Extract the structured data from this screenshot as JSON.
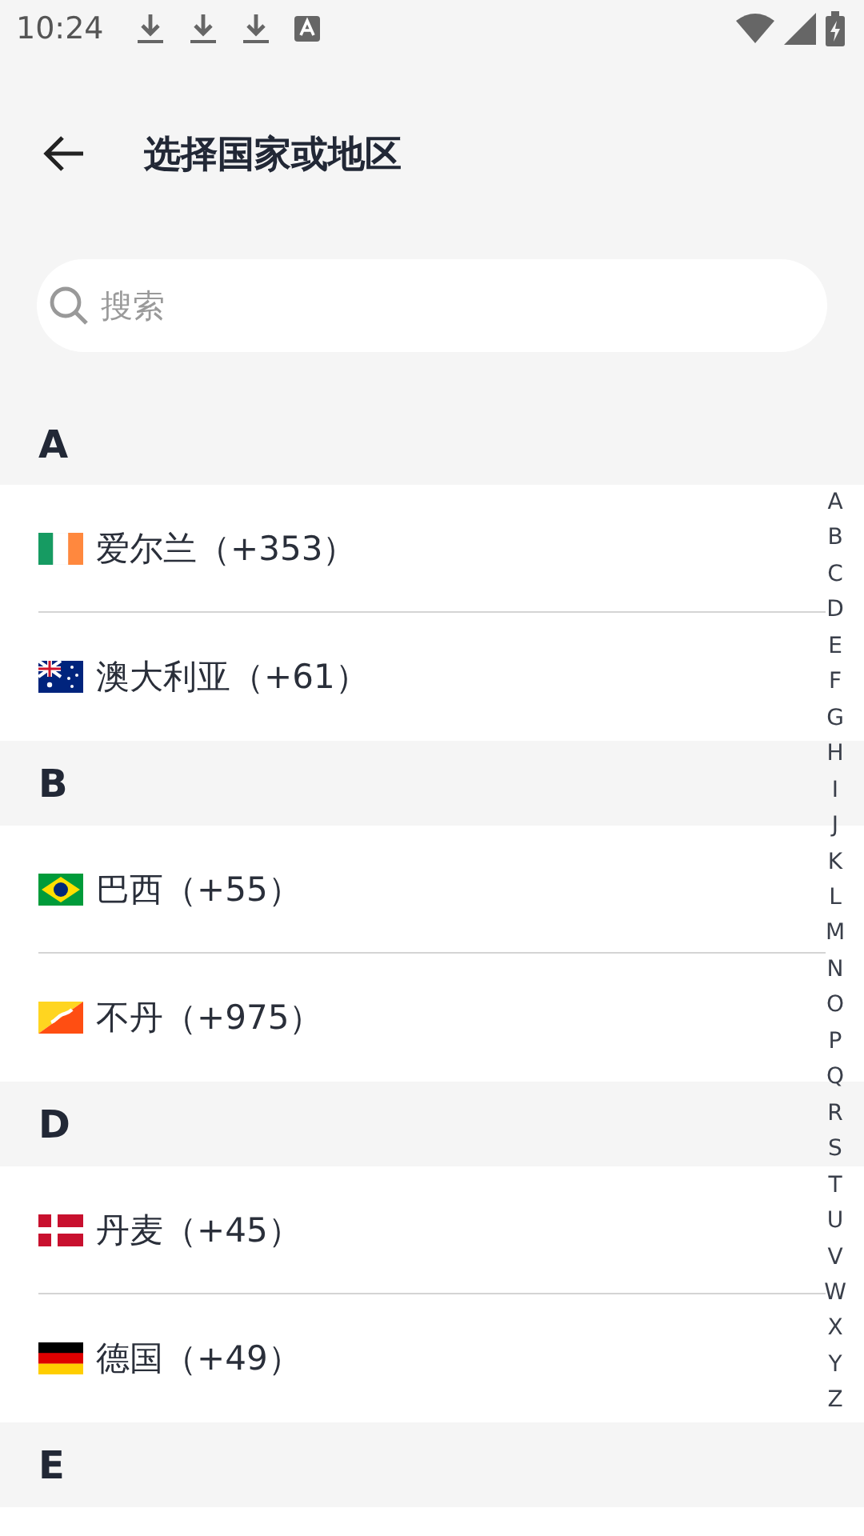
{
  "status_bar": {
    "time": "10:24"
  },
  "header": {
    "title": "选择国家或地区"
  },
  "search": {
    "placeholder": "搜索"
  },
  "sections": [
    {
      "letter": "A",
      "countries": [
        {
          "kind": "ireland",
          "label": "爱尔兰（+353）"
        },
        {
          "kind": "australia",
          "label": "澳大利亚（+61）"
        }
      ]
    },
    {
      "letter": "B",
      "countries": [
        {
          "kind": "brazil",
          "label": "巴西（+55）"
        },
        {
          "kind": "bhutan",
          "label": "不丹（+975）"
        }
      ]
    },
    {
      "letter": "D",
      "countries": [
        {
          "kind": "denmark",
          "label": "丹麦（+45）"
        },
        {
          "kind": "germany",
          "label": "德国（+49）"
        }
      ]
    },
    {
      "letter": "E"
    }
  ],
  "index_bar": [
    "A",
    "B",
    "C",
    "D",
    "E",
    "F",
    "G",
    "H",
    "I",
    "J",
    "K",
    "L",
    "M",
    "N",
    "O",
    "P",
    "Q",
    "R",
    "S",
    "T",
    "U",
    "V",
    "W",
    "X",
    "Y",
    "Z"
  ]
}
